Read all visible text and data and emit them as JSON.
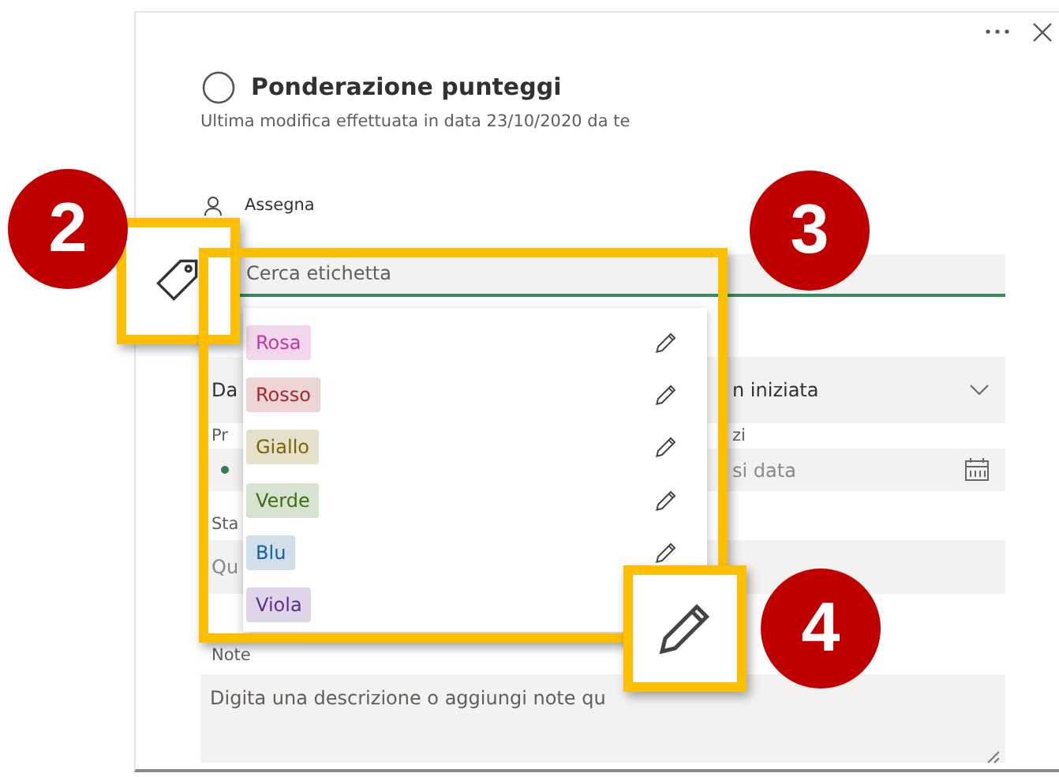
{
  "task": {
    "title": "Ponderazione punteggi",
    "subtitle": "Ultima modifica effettuata in data 23/10/2020 da te",
    "assign_label": "Assegna",
    "completed": false
  },
  "tag_search": {
    "placeholder": "Cerca etichetta"
  },
  "tags": [
    {
      "label": "Rosa",
      "color": "#c0399f",
      "edit_icon_visible": true
    },
    {
      "label": "Rosso",
      "color": "#a4262c",
      "edit_icon_visible": true
    },
    {
      "label": "Giallo",
      "color": "#7a6400",
      "edit_icon_visible": true
    },
    {
      "label": "Verde",
      "color": "#3b6f14",
      "edit_icon_visible": true
    },
    {
      "label": "Blu",
      "color": "#1a5e9a",
      "edit_icon_visible": true
    },
    {
      "label": "Viola",
      "color": "#5c2e91",
      "edit_icon_visible": false
    }
  ],
  "progress_field": {
    "visible_start": "Da",
    "visible_end": "n iniziata"
  },
  "labels_row": {
    "left": "Pr",
    "right": "zi"
  },
  "date_field": {
    "visible_end": "si data"
  },
  "status_label": "Sta",
  "status_field": {
    "visible_start": "Qu"
  },
  "notes_label": "Note",
  "notes": {
    "placeholder": "Digita una descrizione o aggiungi note qu"
  },
  "callouts": [
    {
      "number": "2",
      "kind": "tag"
    },
    {
      "number": "3",
      "kind": "list"
    },
    {
      "number": "4",
      "kind": "pencil"
    }
  ]
}
